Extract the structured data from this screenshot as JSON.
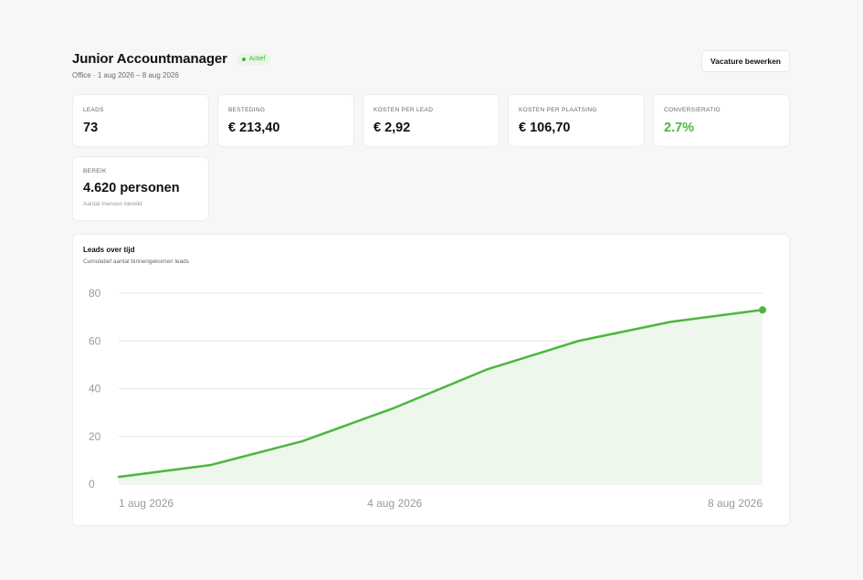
{
  "header": {
    "title": "Junior Accountmanager",
    "status": "Actief",
    "subtitle": "Office · 1 aug 2026 – 8 aug 2026",
    "edit_button": "Vacature bewerken"
  },
  "kpis": [
    {
      "label": "LEADS",
      "value": "73"
    },
    {
      "label": "BESTEDING",
      "value": "€ 213,40"
    },
    {
      "label": "KOSTEN PER LEAD",
      "value": "€ 2,92"
    },
    {
      "label": "KOSTEN PER PLAATSING",
      "value": "€ 106,70"
    },
    {
      "label": "CONVERSIERATIO",
      "value": "2.7%"
    }
  ],
  "reach": {
    "label": "BEREIK",
    "value": "4.620 personen",
    "note": "Aantal mensen bereikt"
  },
  "colors": {
    "accent": "#4ab83c",
    "area_fill": "#eef7ec",
    "grid": "#e6e6e6",
    "axis_text": "#9a9a9a"
  },
  "chart_data": {
    "type": "area",
    "title": "Leads over tijd",
    "subtitle": "Cumulatief aantal binnengekomen leads",
    "x": [
      "1 aug 2026",
      "2 aug 2026",
      "3 aug 2026",
      "4 aug 2026",
      "5 aug 2026",
      "6 aug 2026",
      "7 aug 2026",
      "8 aug 2026"
    ],
    "x_tick_labels": [
      "1 aug 2026",
      "4 aug 2026",
      "8 aug 2026"
    ],
    "y": [
      3,
      8,
      18,
      32,
      48,
      60,
      68,
      73
    ],
    "ylim": [
      0,
      80
    ],
    "y_ticks": [
      0,
      20,
      40,
      60,
      80
    ],
    "grid": true,
    "legend": "none"
  }
}
